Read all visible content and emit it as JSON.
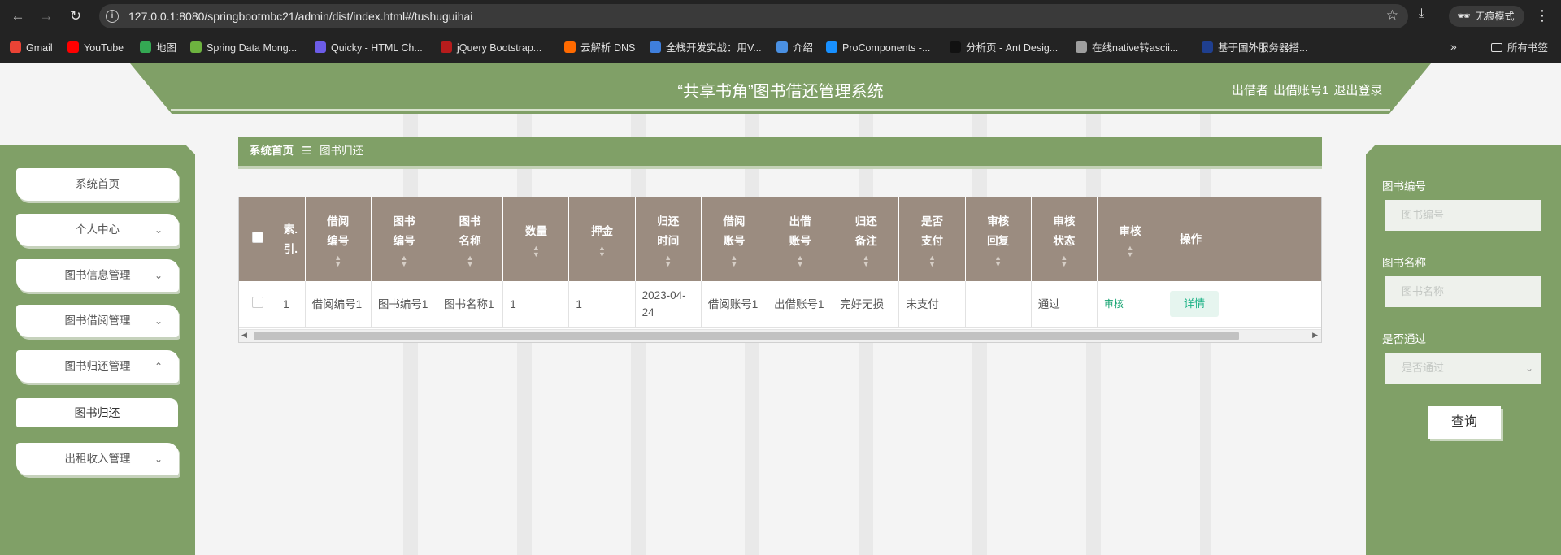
{
  "browser": {
    "url": "127.0.0.1:8080/springbootmbc21/admin/dist/index.html#/tushuguihai",
    "incognito_label": "无痕模式",
    "bookmarks": [
      {
        "label": "Gmail",
        "color": "#ea4335"
      },
      {
        "label": "YouTube",
        "color": "#ff0000"
      },
      {
        "label": "地图",
        "color": "#34a853"
      },
      {
        "label": "Spring Data Mong...",
        "color": "#6db33f"
      },
      {
        "label": "Quicky - HTML Ch...",
        "color": "#6c5ce7"
      },
      {
        "label": "jQuery Bootstrap...",
        "color": "#b71c1c"
      },
      {
        "label": "云解析 DNS",
        "color": "#ff6a00"
      },
      {
        "label": "全栈开发实战：用V...",
        "color": "#3f7fdc"
      },
      {
        "label": "介绍",
        "color": "#4a90e2"
      },
      {
        "label": "ProComponents -...",
        "color": "#1890ff"
      },
      {
        "label": "分析页 - Ant Desig...",
        "color": "#111111"
      },
      {
        "label": "在线native转ascii...",
        "color": "#9e9e9e"
      },
      {
        "label": "基于国外服务器搭...",
        "color": "#1f3f8f"
      }
    ],
    "all_bookmarks": "所有书签"
  },
  "header": {
    "title": "“共享书角”图书借还管理系统",
    "role": "出借者",
    "account": "出借账号1",
    "logout": "退出登录"
  },
  "sidebar": {
    "items": [
      {
        "label": "系统首页",
        "chevron": ""
      },
      {
        "label": "个人中心",
        "chevron": "⌄"
      },
      {
        "label": "图书信息管理",
        "chevron": "⌄"
      },
      {
        "label": "图书借阅管理",
        "chevron": "⌄"
      },
      {
        "label": "图书归还管理",
        "chevron": "⌃"
      }
    ],
    "sub_item": "图书归还",
    "last_item": {
      "label": "出租收入管理",
      "chevron": "⌄"
    }
  },
  "breadcrumb": {
    "home": "系统首页",
    "separator": "☰",
    "current": "图书归还"
  },
  "table": {
    "headers": [
      "",
      "索\n引",
      "借阅\n编号",
      "图书\n编号",
      "图书\n名称",
      "数量",
      "押金",
      "归还\n时间",
      "借阅\n账号",
      "出借\n账号",
      "归还\n备注",
      "是否\n支付",
      "审核\n回复",
      "审核\n状态",
      "审核",
      "操作"
    ],
    "rows": [
      {
        "index": "1",
        "borrow_no": "借阅编号1",
        "book_no": "图书编号1",
        "book_name": "图书名称1",
        "quantity": "1",
        "deposit": "1",
        "return_time": "2023-04-24",
        "borrower": "借阅账号1",
        "lender": "出借账号1",
        "remark": "完好无损",
        "paid": "未支付",
        "reply": "",
        "status": "通过",
        "audit": "审核",
        "action": "详情"
      }
    ]
  },
  "search_panel": {
    "book_no_label": "图书编号",
    "book_no_placeholder": "图书编号",
    "book_name_label": "图书名称",
    "book_name_placeholder": "图书名称",
    "approved_label": "是否通过",
    "approved_placeholder": "是否通过",
    "query_button": "查询"
  },
  "colors": {
    "accent": "#80a067",
    "table_header": "#9b8c80",
    "link": "#15a371"
  }
}
